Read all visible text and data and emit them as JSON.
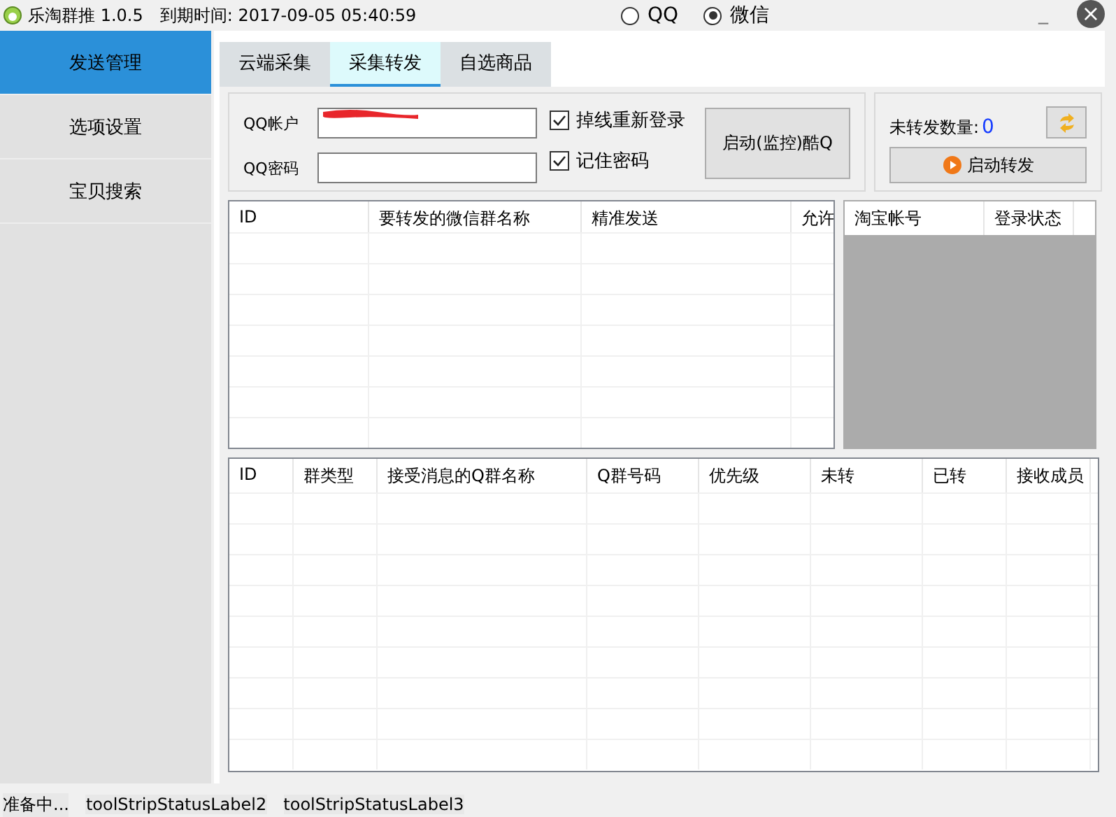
{
  "window": {
    "title": "乐淘群推 1.0.5",
    "expiry": "到期时间: 2017-09-05 05:40:59",
    "minimize": "_",
    "close": "×"
  },
  "mode_options": [
    {
      "label": "QQ",
      "selected": false
    },
    {
      "label": "微信",
      "selected": true
    }
  ],
  "sidebar": {
    "items": [
      {
        "label": "发送管理",
        "selected": true
      },
      {
        "label": "选项设置",
        "selected": false
      },
      {
        "label": "宝贝搜索",
        "selected": false
      }
    ]
  },
  "tabs": [
    {
      "label": "云端采集",
      "selected": false
    },
    {
      "label": "采集转发",
      "selected": true
    },
    {
      "label": "自选商品",
      "selected": false
    }
  ],
  "login": {
    "account_label": "QQ帐户",
    "password_label": "QQ密码",
    "account_redacted": true,
    "options": [
      {
        "label": "掉线重新登录",
        "checked": true
      },
      {
        "label": "记住密码",
        "checked": true
      }
    ],
    "start_button": "启动(监控)酷Q"
  },
  "forward": {
    "count_label": "未转发数量:",
    "count": "0",
    "start_button": "启动转发"
  },
  "wechat_table": {
    "columns": [
      "ID",
      "要转发的微信群名称",
      "精准发送",
      "允许"
    ]
  },
  "taobao_table": {
    "columns": [
      "淘宝帐号",
      "登录状态"
    ]
  },
  "qq_table": {
    "columns": [
      "ID",
      "群类型",
      "接受消息的Q群名称",
      "Q群号码",
      "优先级",
      "未转",
      "已转",
      "接收成员"
    ]
  },
  "status_bar": [
    "准备中...",
    "toolStripStatusLabel2",
    "toolStripStatusLabel3"
  ]
}
